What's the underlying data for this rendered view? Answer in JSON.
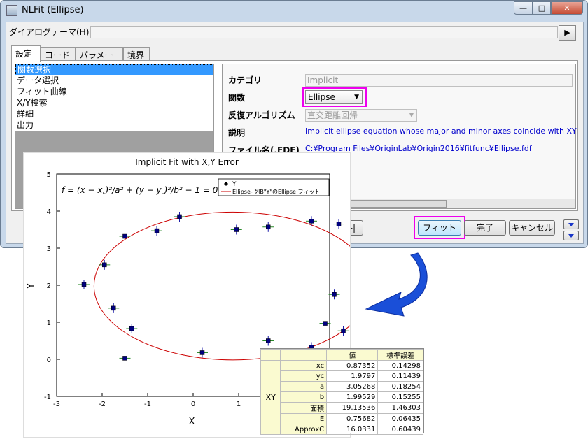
{
  "window": {
    "title": "NLFit (Ellipse)"
  },
  "dialog_theme": {
    "label": "ダイアログテーマ(H)",
    "value": ""
  },
  "tabs": [
    {
      "label": "設定"
    },
    {
      "label": "コード"
    },
    {
      "label": "パラメータ"
    },
    {
      "label": "境界"
    }
  ],
  "tree": {
    "items": [
      "関数選択",
      "データ選択",
      "フィット曲線",
      "X/Y検索",
      "詳細",
      "出力"
    ],
    "selected": "関数選択"
  },
  "props": {
    "category_label": "カテゴリ",
    "category_value": "Implicit",
    "function_label": "関数",
    "function_value": "Ellipse",
    "iter_label": "反復アルゴリズム",
    "iter_value": "直交距離回帰",
    "desc_label": "説明",
    "desc_value": "Implicit ellipse equation whose major and minor axes coincide with XY",
    "file_label": "ファイル名(.FDF)",
    "file_value": "C:¥Program Files¥OriginLab¥Origin2016¥fitfunc¥Ellipse.fdf"
  },
  "buttons": {
    "fit": "フィット",
    "done": "完了",
    "cancel": "キャンセル",
    "next": "▸|"
  },
  "colors": {
    "highlight": "#ee00ee",
    "accent_arrow": "#1a4fd8",
    "ellipse": "#cc0000",
    "point": "#000080"
  },
  "graph": {
    "title": "Implicit Fit with X,Y Error",
    "xlabel": "X",
    "ylabel": "Y",
    "formula": "f = (x − xc)²/a² + (y − yc)²/b² − 1 = 0",
    "legend": [
      "Y",
      "Ellipse- 列B\"Y\"のEllipse フィット"
    ]
  },
  "chart_data": {
    "type": "scatter",
    "title": "Implicit Fit with X,Y Error",
    "xlabel": "X",
    "ylabel": "Y",
    "xlim": [
      -3,
      3
    ],
    "ylim": [
      -1,
      5
    ],
    "xticks": [
      "-3",
      "-2",
      "-1",
      "0",
      "1",
      "2",
      "3"
    ],
    "yticks": [
      "-1",
      "0",
      "1",
      "2",
      "3",
      "4",
      "5"
    ],
    "series": [
      {
        "name": "Y",
        "points": [
          [
            -2.4,
            2.02
          ],
          [
            -1.95,
            2.55
          ],
          [
            -1.75,
            1.38
          ],
          [
            -1.5,
            3.32
          ],
          [
            -1.5,
            0.03
          ],
          [
            -1.35,
            0.83
          ],
          [
            -0.8,
            3.47
          ],
          [
            -0.3,
            3.85
          ],
          [
            0.2,
            0.18
          ],
          [
            0.95,
            3.5
          ],
          [
            1.65,
            3.57
          ],
          [
            1.65,
            0.5
          ],
          [
            2.1,
            -0.15
          ],
          [
            2.6,
            3.73
          ],
          [
            2.6,
            0.33
          ],
          [
            2.9,
            0.97
          ],
          [
            3.1,
            1.75
          ],
          [
            3.2,
            3.65
          ],
          [
            3.3,
            0.77
          ],
          [
            3.6,
            2.57
          ]
        ]
      }
    ],
    "ellipse_fit": {
      "name": "Ellipse- 列B\"Y\"のEllipse フィット",
      "xc": 0.87352,
      "yc": 1.9797,
      "a": 3.05268,
      "b": 1.99529
    }
  },
  "results": {
    "headers": [
      "値",
      "標準誤差"
    ],
    "group": "XY",
    "rows": [
      {
        "name": "xc",
        "value": "0.87352",
        "se": "0.14298"
      },
      {
        "name": "yc",
        "value": "1.9797",
        "se": "0.11439"
      },
      {
        "name": "a",
        "value": "3.05268",
        "se": "0.18254"
      },
      {
        "name": "b",
        "value": "1.99529",
        "se": "0.15255"
      },
      {
        "name": "面積",
        "value": "19.13536",
        "se": "1.46303"
      },
      {
        "name": "E",
        "value": "0.75682",
        "se": "0.06435"
      },
      {
        "name": "ApproxC",
        "value": "16.0331",
        "se": "0.60439"
      }
    ]
  }
}
